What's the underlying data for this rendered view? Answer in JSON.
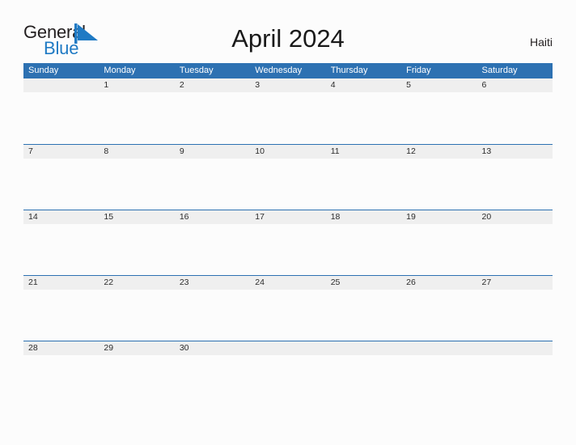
{
  "brand": {
    "word_top": "General",
    "word_bottom": "Blue",
    "mark_icon": "blue-triangle-logo-icon",
    "colors": {
      "top_text": "#231f20",
      "bottom_text": "#1f7ac4",
      "mark": "#1f7ac4"
    }
  },
  "header": {
    "title": "April 2024",
    "locale": "Haiti"
  },
  "calendar": {
    "weekdays": [
      "Sunday",
      "Monday",
      "Tuesday",
      "Wednesday",
      "Thursday",
      "Friday",
      "Saturday"
    ],
    "colors": {
      "header_bg": "#2d71b2",
      "header_text": "#ffffff",
      "row_rule": "#2d71b2",
      "date_band": "#efefef",
      "date_text": "#2b2b2b",
      "cell_bg": "#fcfcfc"
    },
    "weeks": [
      [
        "",
        "1",
        "2",
        "3",
        "4",
        "5",
        "6"
      ],
      [
        "7",
        "8",
        "9",
        "10",
        "11",
        "12",
        "13"
      ],
      [
        "14",
        "15",
        "16",
        "17",
        "18",
        "19",
        "20"
      ],
      [
        "21",
        "22",
        "23",
        "24",
        "25",
        "26",
        "27"
      ],
      [
        "28",
        "29",
        "30",
        "",
        "",
        "",
        ""
      ]
    ]
  }
}
